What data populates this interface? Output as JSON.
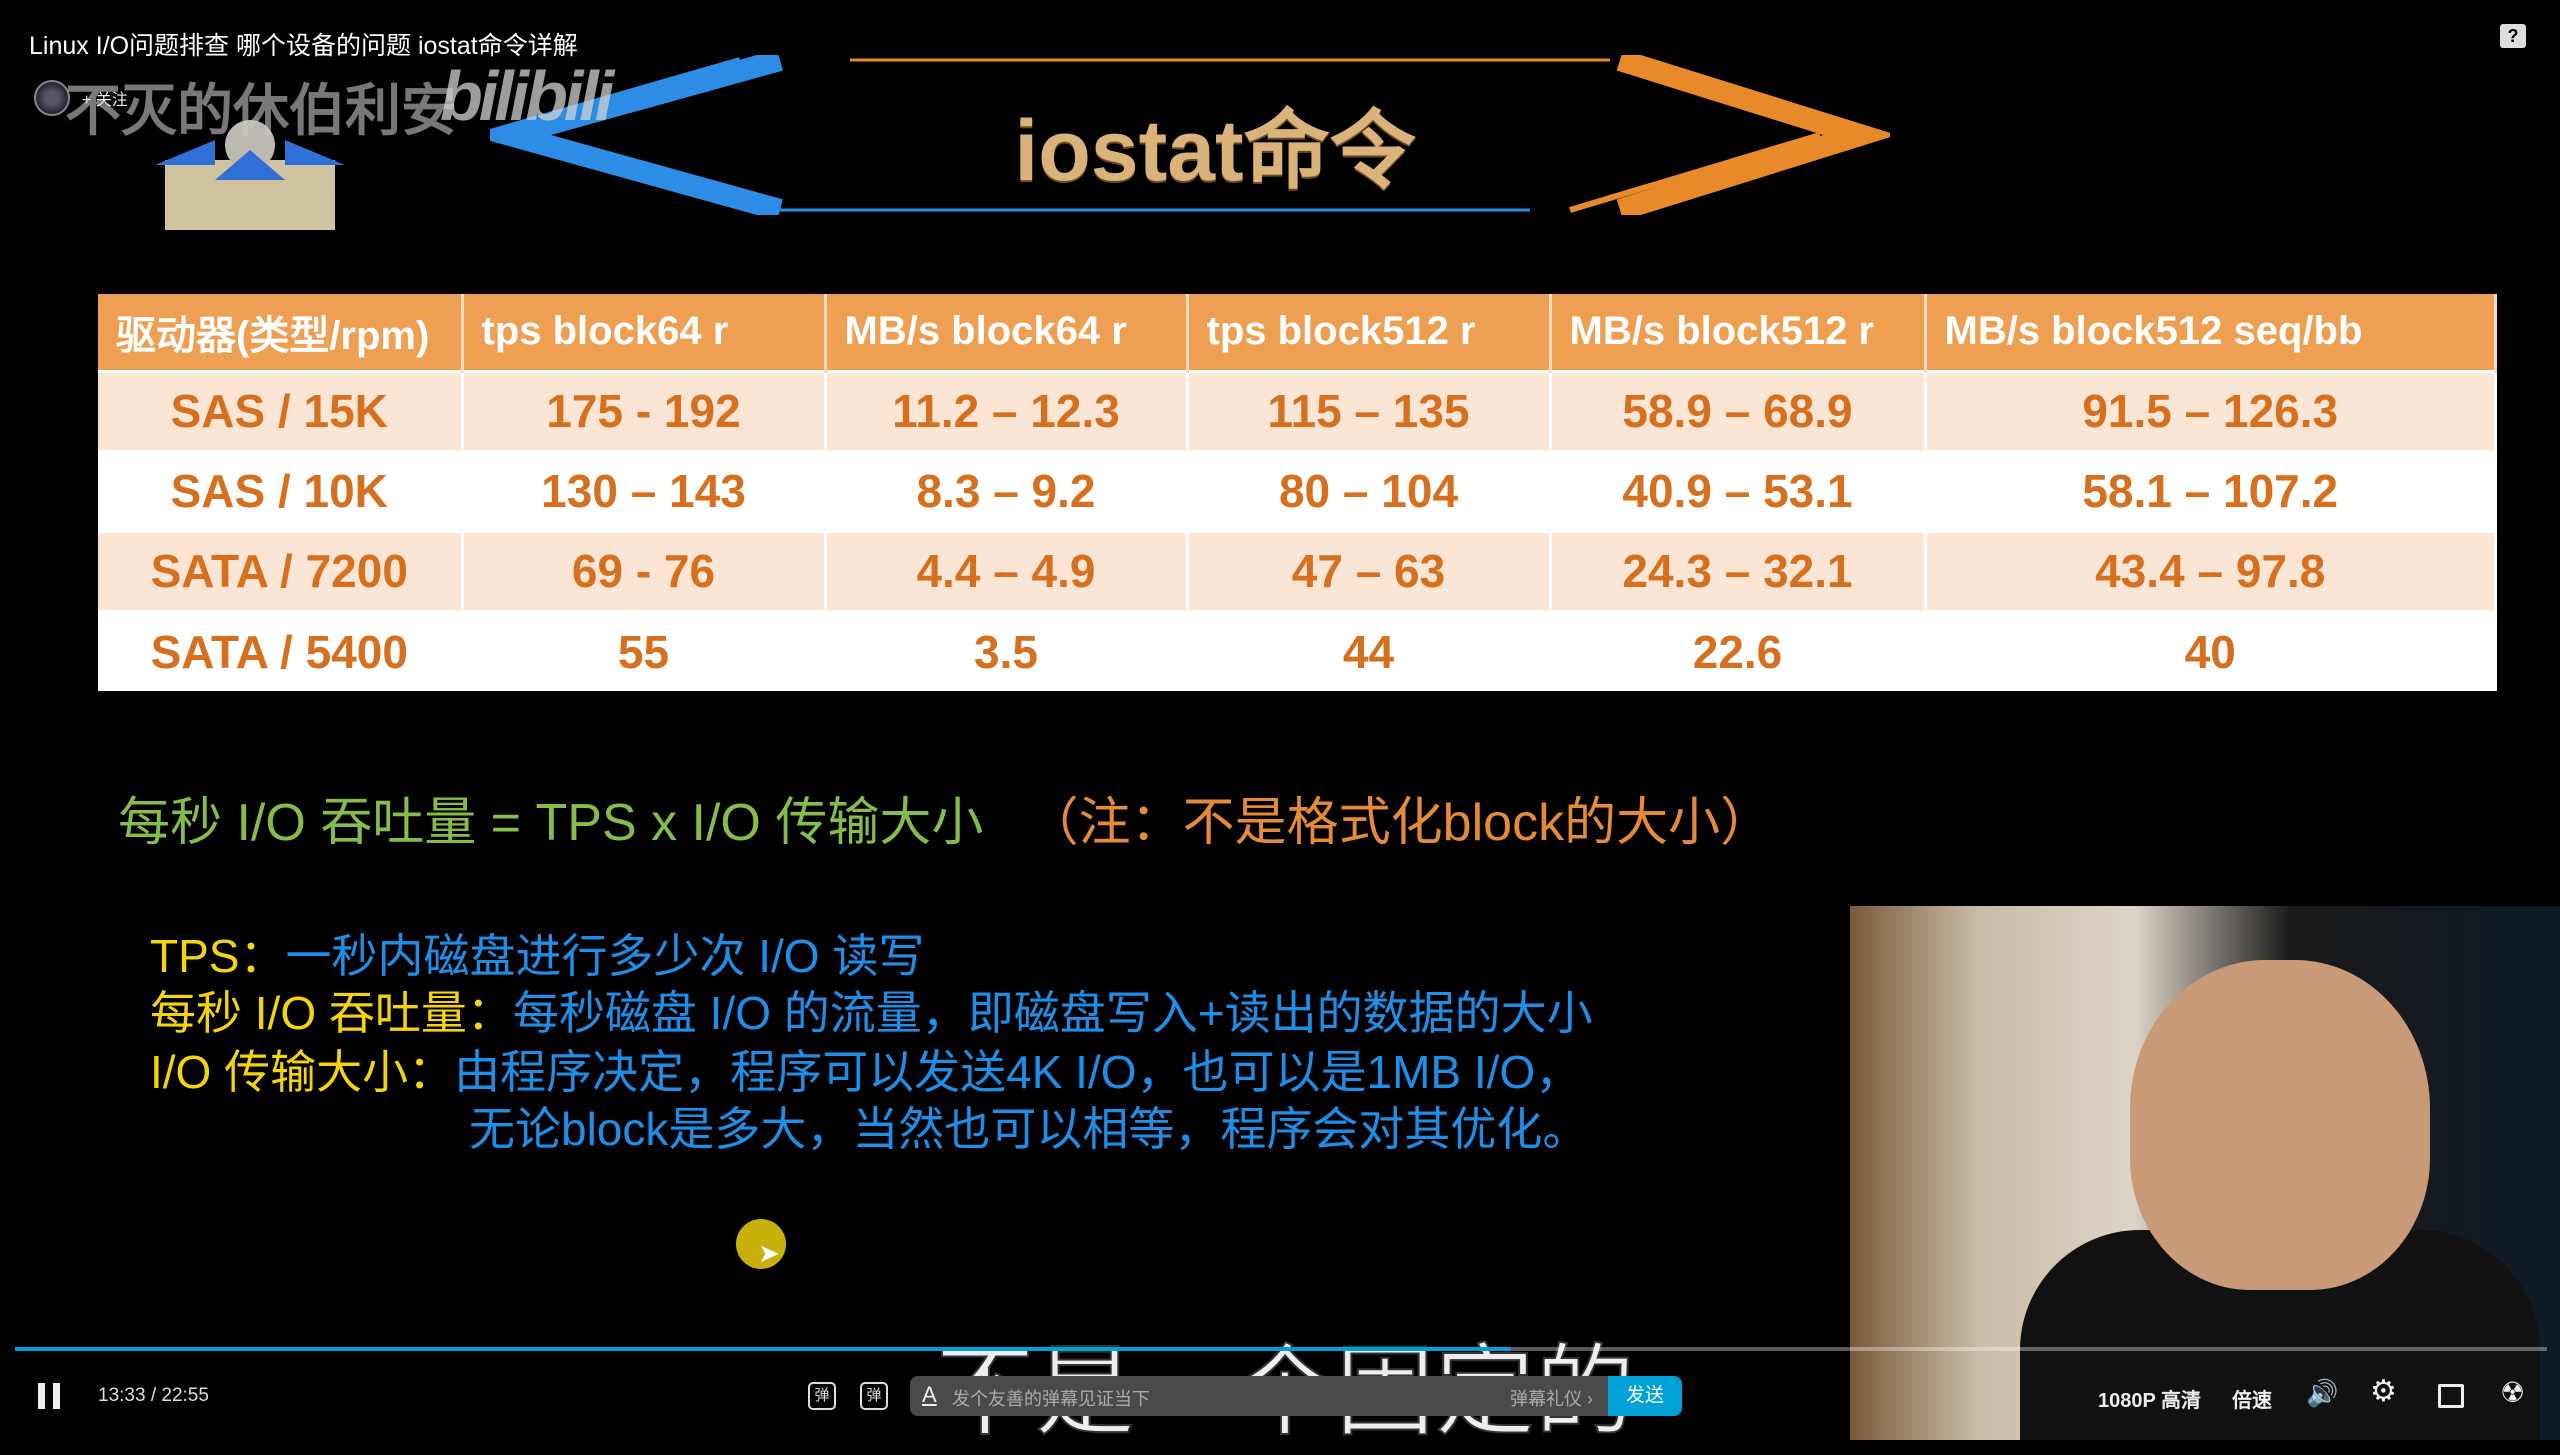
{
  "video_title": "Linux I/O问题排查 哪个设备的问题 iostat命令详解",
  "uploader": {
    "name": "不灭的休伯利安",
    "follow_label": "+ 关注",
    "platform_logo": "bilibili"
  },
  "help_icon": "?",
  "slide": {
    "heading": "iostat命令",
    "table": {
      "headers": [
        "驱动器(类型/rpm)",
        "tps block64 r",
        "MB/s block64 r",
        "tps block512 r",
        "MB/s block512 r",
        "MB/s block512 seq/bb"
      ],
      "rows": [
        [
          "SAS / 15K",
          "175 - 192",
          "11.2 – 12.3",
          "115 – 135",
          "58.9 – 68.9",
          "91.5 – 126.3"
        ],
        [
          "SAS / 10K",
          "130 – 143",
          "8.3 – 9.2",
          "80 – 104",
          "40.9 – 53.1",
          "58.1 – 107.2"
        ],
        [
          "SATA / 7200",
          "69 - 76",
          "4.4 – 4.9",
          "47 – 63",
          "24.3 – 32.1",
          "43.4 – 97.8"
        ],
        [
          "SATA / 5400",
          "55",
          "3.5",
          "44",
          "22.6",
          "40"
        ]
      ]
    },
    "formula": {
      "main": "每秒 I/O 吞吐量 = TPS x I/O 传输大小",
      "note": "（注：不是格式化block的大小）"
    },
    "definitions": [
      {
        "term": "TPS：",
        "text": "一秒内磁盘进行多少次 I/O 读写"
      },
      {
        "term": "每秒 I/O 吞吐量：",
        "text": "每秒磁盘 I/O 的流量，即磁盘写入+读出的数据的大小"
      },
      {
        "term": "I/O 传输大小：",
        "text": "由程序决定，程序可以发送4K I/O，也可以是1MB I/O，"
      },
      {
        "term": "",
        "text": "无论block是多大，当然也可以相等，程序会对其优化。"
      }
    ]
  },
  "subtitle": "不是一个固定的",
  "player": {
    "current_time": "13:33",
    "duration": "22:55",
    "progress_fraction": 0.591,
    "danmaku_placeholder": "发个友善的弹幕见证当下",
    "danmaku_etiquette": "弹幕礼仪 ›",
    "send_label": "发送",
    "danmaku_toggle_icon": "弹",
    "quality": "1080P 高清",
    "speed": "倍速",
    "colors": {
      "accent": "#00a1d6",
      "table_header": "#ef9f51",
      "table_text": "#d6701f"
    }
  }
}
